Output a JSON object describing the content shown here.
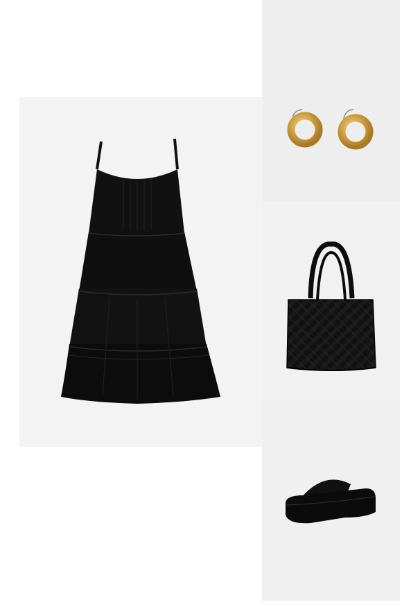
{
  "outfit": {
    "items": [
      {
        "id": "dress",
        "icon": "black-tiered-dress-image",
        "background": "#f3f3f3"
      },
      {
        "id": "earrings",
        "icon": "gold-hoop-earrings-image",
        "background": "#eeeeee"
      },
      {
        "id": "bag",
        "icon": "black-woven-tote-bag-image",
        "background": "#f1f1f1"
      },
      {
        "id": "sandal",
        "icon": "black-platform-sandal-image",
        "background": "#f0f0f0"
      }
    ]
  },
  "colors": {
    "page_background": "#ffffff",
    "product_black": "#0d0d0d",
    "gold": "#d2a447"
  }
}
